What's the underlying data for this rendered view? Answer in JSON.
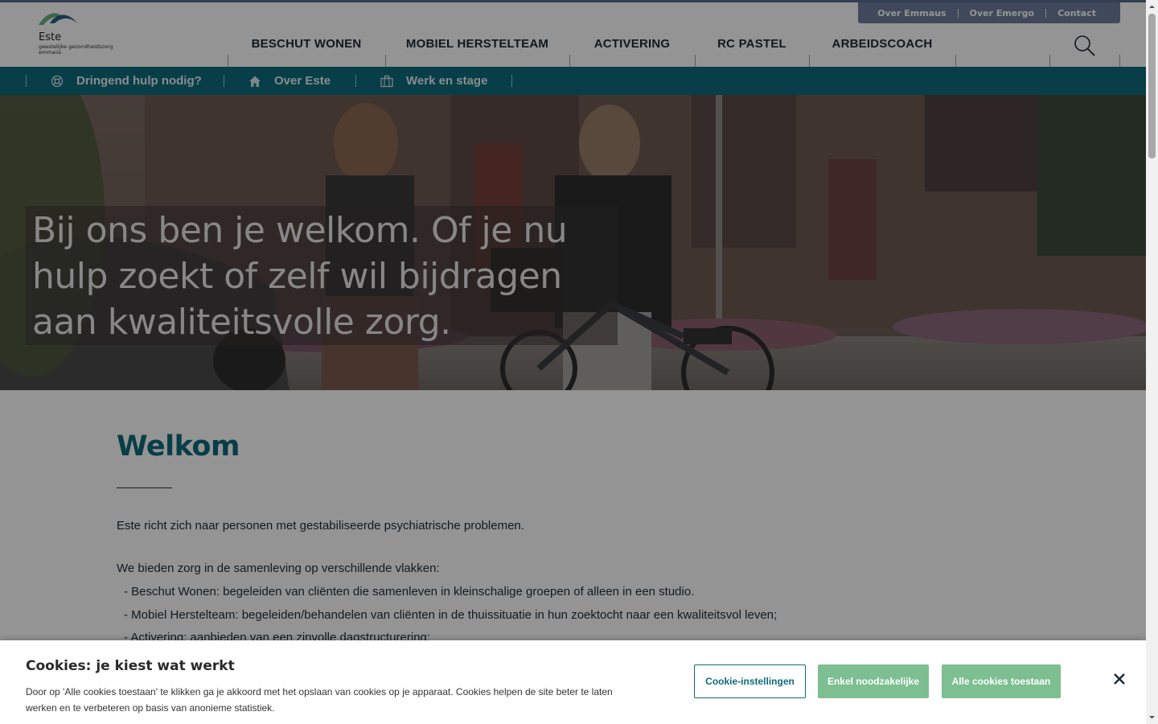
{
  "utility_nav": [
    "Over Emmaus",
    "Over Emergo",
    "Contact"
  ],
  "logo": {
    "name": "Este",
    "subtitle_1": "geestelijke gezondheidszorg",
    "subtitle_2": "emmaüs"
  },
  "main_nav": [
    "BESCHUT WONEN",
    "MOBIEL HERSTELTEAM",
    "ACTIVERING",
    "RC PASTEL",
    "ARBEIDSCOACH"
  ],
  "sub_nav": [
    {
      "label": "Dringend hulp nodig?",
      "icon": "lifebuoy-icon"
    },
    {
      "label": "Over Este",
      "icon": "home-icon"
    },
    {
      "label": "Werk en stage",
      "icon": "briefcase-icon"
    }
  ],
  "hero": {
    "title": "Bij ons ben je welkom. Of je nu hulp zoekt of zelf wil bijdragen aan kwaliteitsvolle zorg."
  },
  "content": {
    "title": "Welkom",
    "intro": "Este richt zich naar personen met gestabiliseerde psychiatrische problemen.",
    "lead": "We bieden zorg in de samenleving op verschillende vlakken:",
    "items": [
      "- Beschut Wonen: begeleiden van cliënten die samenleven in kleinschalige groepen of alleen in een studio.",
      "- Mobiel Herstelteam: begeleiden/behandelen van cliënten in de thuissituatie in hun zoektocht naar een kwaliteitsvol leven;",
      "- Activering: aanbieden van een zinvolle dagstructurering;"
    ]
  },
  "cookie": {
    "title": "Cookies: je kiest wat werkt",
    "text": "Door op 'Alle cookies toestaan' te klikken ga je akkoord met het opslaan van cookies op je apparaat. Cookies helpen de site beter te laten werken en te verbeteren op basis van anonieme statistiek.",
    "settings_label": "Cookie-instellingen",
    "essential_label": "Enkel noodzakelijke",
    "accept_all_label": "Alle cookies toestaan",
    "close_icon": "close-icon"
  },
  "colors": {
    "teal": "#0e6b7c",
    "green_button": "#7dbf91",
    "utility_bar": "#6e7f9e",
    "heading": "#0d6b7a"
  }
}
